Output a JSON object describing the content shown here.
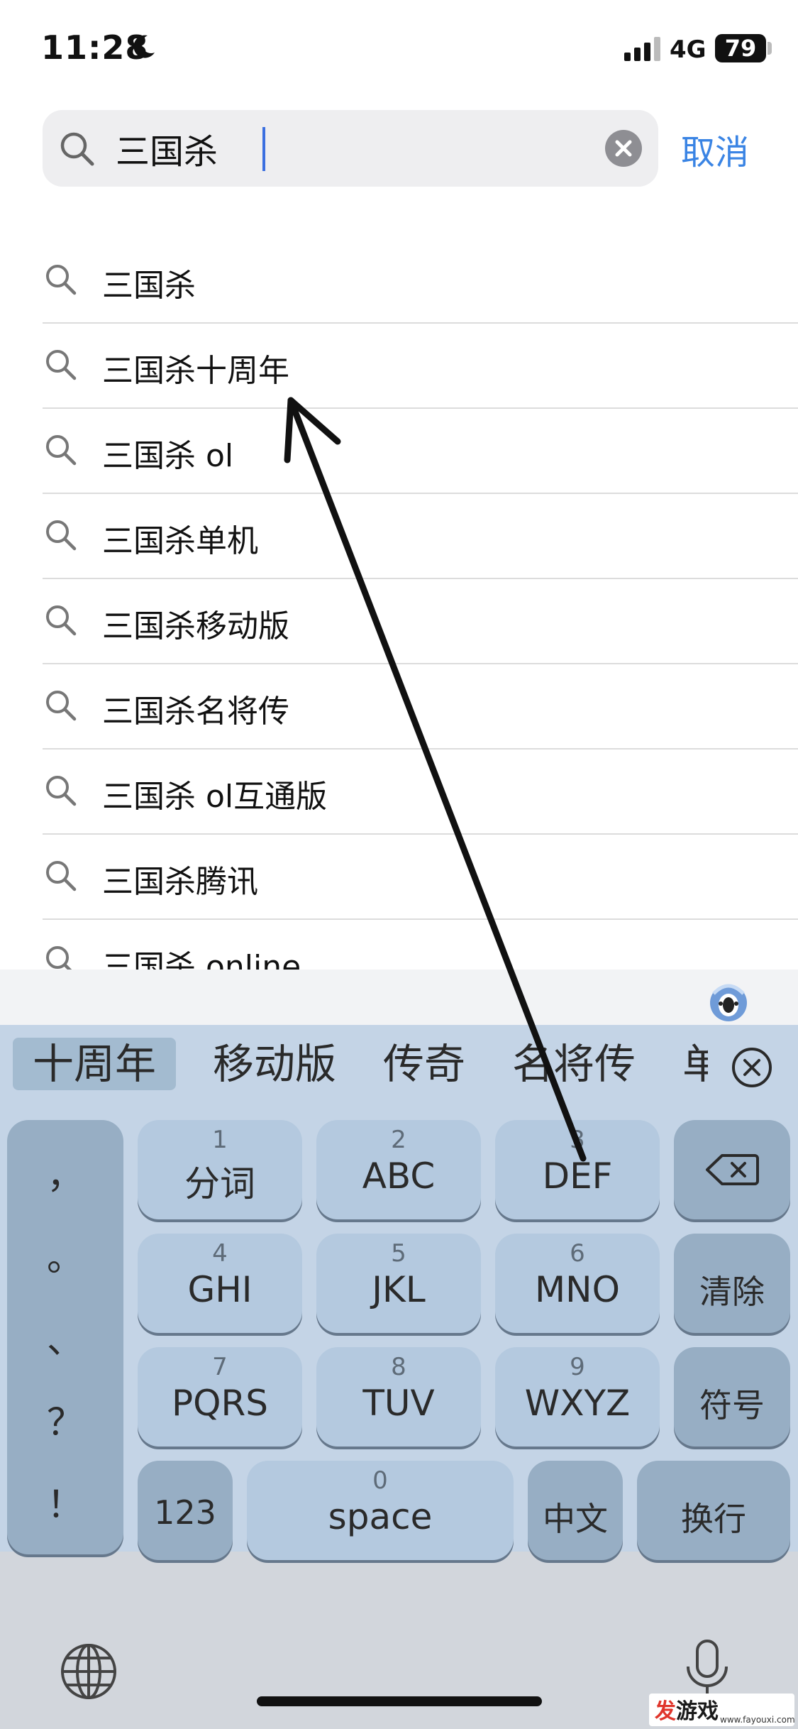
{
  "status_bar": {
    "time": "11:28",
    "network": "4G",
    "battery": "79"
  },
  "search": {
    "query": "三国杀",
    "cancel_label": "取消"
  },
  "suggestions": [
    "三国杀",
    "三国杀十周年",
    "三国杀 ol",
    "三国杀单机",
    "三国杀移动版",
    "三国杀名将传",
    "三国杀 ol互通版",
    "三国杀腾讯",
    "三国杀 online"
  ],
  "keyboard": {
    "candidates": [
      "十周年",
      "移动版",
      "传奇",
      "名将传",
      "单"
    ],
    "punctuation": [
      "，",
      "。",
      "、",
      "？",
      "！"
    ],
    "keys": [
      {
        "num": "1",
        "label": "分词"
      },
      {
        "num": "2",
        "label": "ABC"
      },
      {
        "num": "3",
        "label": "DEF"
      },
      {
        "num": "4",
        "label": "GHI"
      },
      {
        "num": "5",
        "label": "JKL"
      },
      {
        "num": "6",
        "label": "MNO"
      },
      {
        "num": "7",
        "label": "PQRS"
      },
      {
        "num": "8",
        "label": "TUV"
      },
      {
        "num": "9",
        "label": "WXYZ"
      }
    ],
    "clear_label": "清除",
    "symbol_label": "符号",
    "num_label": "123",
    "space_num": "0",
    "space_label": "space",
    "lang_label": "中文",
    "return_label": "换行"
  },
  "watermark": {
    "brand_red": "发",
    "brand_rest": "游戏",
    "url": "www.fayouxi.com"
  },
  "colors": {
    "accent": "#3a84e4",
    "keyboard_bg": "#c4d4e6",
    "key": "#b4c9df",
    "key_dark": "#97aec4"
  }
}
